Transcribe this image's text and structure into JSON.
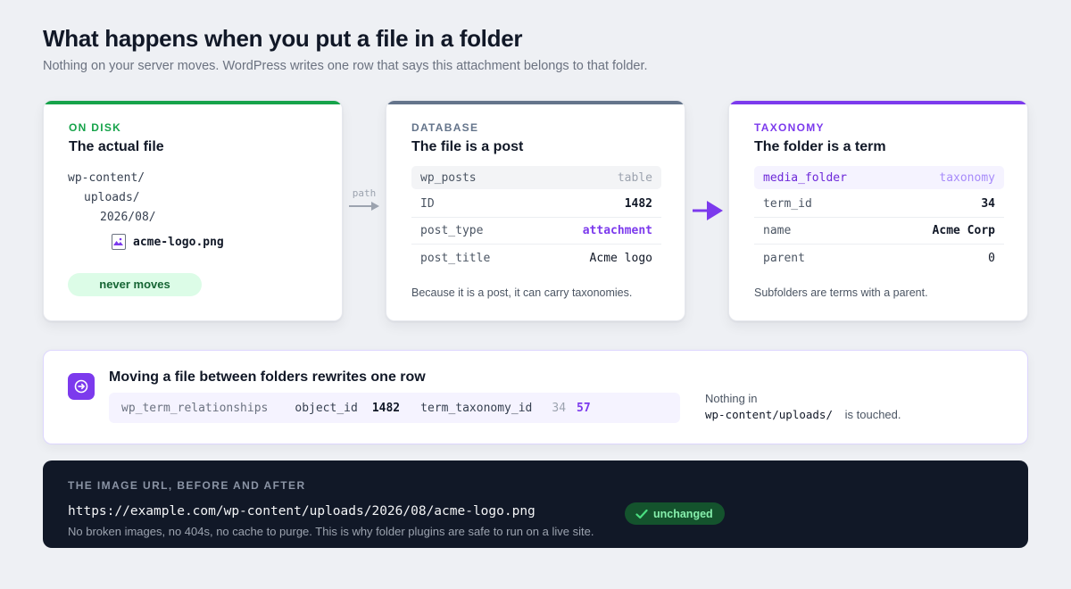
{
  "header": {
    "title": "What happens when you put a file in a folder",
    "subtitle": "Nothing on your server moves. WordPress writes one row that says this attachment belongs to that folder."
  },
  "colors": {
    "disk_accent": "#16a34a",
    "db_accent": "#64748b",
    "tax_accent": "#7c3aed",
    "dark_panel": "#111827"
  },
  "disk": {
    "eyebrow": "ON DISK",
    "title": "The actual file",
    "tree": [
      "wp-content/",
      "uploads/",
      "2026/08/"
    ],
    "file_name": "acme-logo.png",
    "file_icon": "image-file-icon",
    "badge": "never moves"
  },
  "connector": {
    "path_label": "path"
  },
  "database": {
    "eyebrow": "DATABASE",
    "title": "The file is a post",
    "table_name": "wp_posts",
    "table_kind": "table",
    "rows": [
      {
        "key": "ID",
        "value": "1482"
      },
      {
        "key": "post_type",
        "value": "attachment"
      },
      {
        "key": "post_title",
        "value": "Acme logo"
      }
    ],
    "note": "Because it is a post, it can carry taxonomies."
  },
  "taxonomy": {
    "eyebrow": "TAXONOMY",
    "title": "The folder is a term",
    "table_name": "media_folder",
    "table_kind": "taxonomy",
    "rows": [
      {
        "key": "term_id",
        "value": "34"
      },
      {
        "key": "name",
        "value": "Acme Corp"
      },
      {
        "key": "parent",
        "value": "0"
      }
    ],
    "note": "Subfolders are terms with a parent."
  },
  "move": {
    "icon": "arrow-right-icon",
    "title": "Moving a file between folders rewrites one row",
    "table": "wp_term_relationships",
    "object_id_label": "object_id",
    "object_id_value": "1482",
    "tt_label": "term_taxonomy_id",
    "tt_old": "34",
    "tt_new": "57",
    "note_line1": "Nothing in",
    "note_path": "wp-content/uploads/",
    "note_suffix": "is touched."
  },
  "url": {
    "eyebrow": "THE IMAGE URL, BEFORE AND AFTER",
    "value": "https://example.com/wp-content/uploads/2026/08/acme-logo.png",
    "badge": "unchanged",
    "note": "No broken images, no 404s, no cache to purge. This is why folder plugins are safe to run on a live site."
  }
}
